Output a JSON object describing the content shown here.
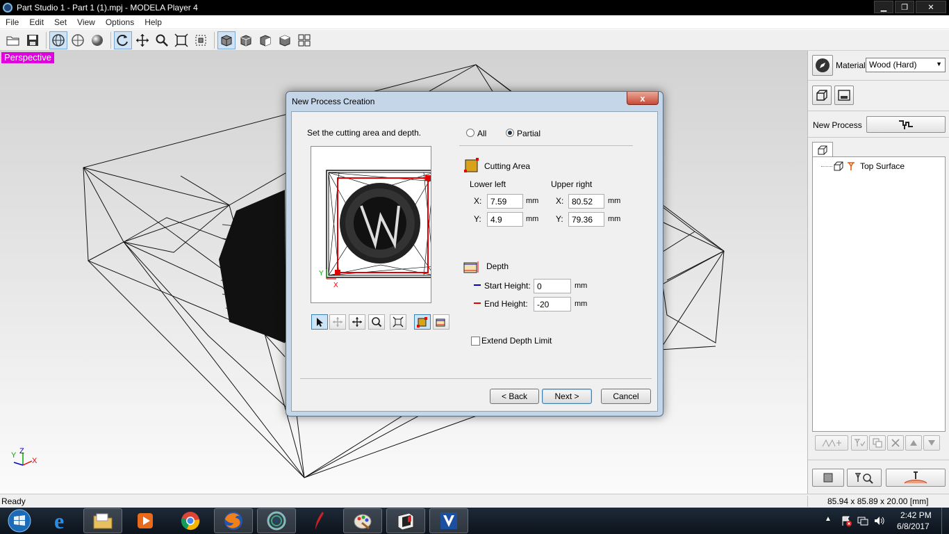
{
  "window": {
    "title": "Part Studio 1 - Part 1 (1).mpj - MODELA Player 4",
    "minimize": "▁",
    "restore": "❐",
    "close": "✕"
  },
  "menu": [
    "File",
    "Edit",
    "Set",
    "View",
    "Options",
    "Help"
  ],
  "toolbar": {
    "icons": [
      "open-icon",
      "save-icon",
      "globe-icon",
      "globe-outline-icon",
      "sphere-icon",
      "rotate-icon",
      "move-icon",
      "zoom-icon",
      "fit-icon",
      "fit-selection-icon",
      "view-perspective-icon",
      "view-front-icon",
      "view-right-icon",
      "view-top-icon",
      "view-multi-icon"
    ]
  },
  "viewport": {
    "label": "Perspective",
    "axes": {
      "y": "Y",
      "z": "Z",
      "x": "X"
    }
  },
  "right_panel": {
    "material_label": "Material",
    "material_value": "Wood (Hard)",
    "new_process_label": "New Process",
    "tree_item": "Top Surface"
  },
  "dialog": {
    "title": "New Process Creation",
    "close": "x",
    "instruction": "Set the cutting area and depth.",
    "radio_all": "All",
    "radio_partial": "Partial",
    "cutting_area_label": "Cutting Area",
    "lower_left_label": "Lower left",
    "upper_right_label": "Upper right",
    "x_label": "X:",
    "y_label": "Y:",
    "unit": "mm",
    "lower_left_x": "7.59",
    "lower_left_y": "4.9",
    "upper_right_x": "80.52",
    "upper_right_y": "79.36",
    "depth_label": "Depth",
    "start_height_label": "Start Height:",
    "start_height": "0",
    "end_height_label": "End Height:",
    "end_height": "-20",
    "extend_depth_label": "Extend Depth Limit",
    "back_button": "< Back",
    "next_button": "Next >",
    "cancel_button": "Cancel",
    "preview_axis_y": "Y",
    "preview_axis_x": "X"
  },
  "status": {
    "left": "Ready",
    "right": "85.94 x 85.89 x 20.00 [mm]"
  },
  "taskbar": {
    "time": "2:42 PM",
    "date": "6/8/2017",
    "apps": [
      "ie-icon",
      "explorer-icon",
      "media-player-icon",
      "chrome-icon",
      "firefox-icon",
      "modela-icon",
      "feather-app-icon",
      "paint-icon",
      "cutting-app-icon",
      "vpanel-icon"
    ]
  },
  "colors": {
    "titlebar": "#000000",
    "perspective_label": "#e000e0",
    "accent": "#3c7fb1",
    "red_line": "#e00000",
    "blue_line": "#0000c0",
    "cutting_area_fill": "#d9a21b"
  }
}
